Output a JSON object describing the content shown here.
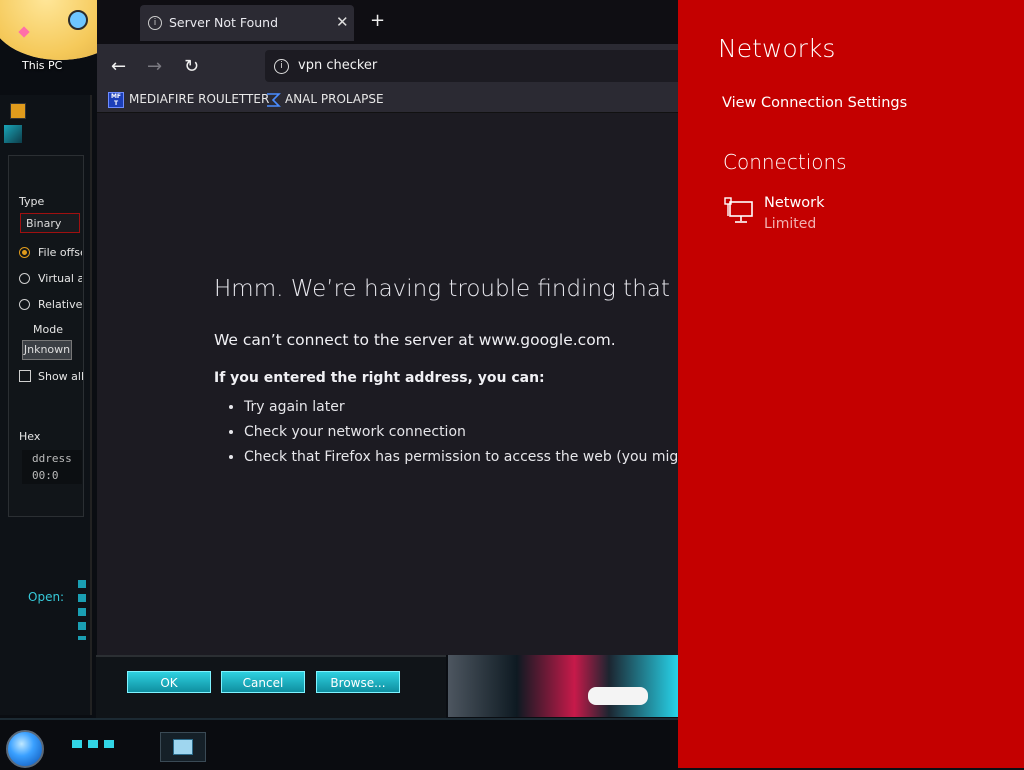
{
  "desktop": {
    "icon_label": "This PC"
  },
  "dialog": {
    "type_label": "Type",
    "type_value": "Binary",
    "radio_file_offset": "File offse",
    "radio_virtual": "Virtual ad",
    "radio_relative": "Relative",
    "mode_label": "Mode",
    "mode_value": "Jnknown",
    "show_all_label": "Show all",
    "hex_label": "Hex",
    "hex_line1": "ddress",
    "hex_line2": "00:0",
    "open_label": "Open:",
    "ok_label": "OK",
    "cancel_label": "Cancel",
    "browse_label": "Browse..."
  },
  "browser": {
    "tab_title": "Server Not Found",
    "tab_close": "✕",
    "new_tab": "+",
    "back": "←",
    "forward": "→",
    "reload": "↻",
    "url": "vpn checker",
    "bookmarks": [
      {
        "label": "MEDIAFIRE ROULETTER",
        "icon": "mediafire-icon",
        "icon_text": "MF T"
      },
      {
        "label": "ANAL PROLAPSE",
        "icon": "sigma-icon"
      }
    ],
    "error": {
      "title": "Hmm. We’re having trouble finding that sit",
      "subtitle": "We can’t connect to the server at www.google.com.",
      "hint": "If you entered the right address, you can:",
      "items": [
        "Try again later",
        "Check your network connection",
        "Check that Firefox has permission to access the web (you might be"
      ]
    }
  },
  "flyout": {
    "title": "Networks",
    "view_settings": "View Connection Settings",
    "connections_heading": "Connections",
    "network_name": "Network",
    "network_status": "Limited",
    "background_color": "#c40000"
  }
}
